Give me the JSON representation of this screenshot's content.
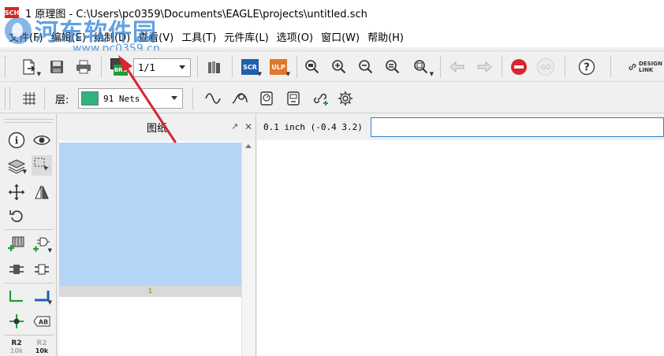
{
  "window": {
    "app_icon_text": "SCH",
    "title": "1 原理图 - C:\\Users\\pc0359\\Documents\\EAGLE\\projects\\untitled.sch"
  },
  "menu": {
    "items": [
      {
        "label": "文件(F)"
      },
      {
        "label": "编辑(E)"
      },
      {
        "label": "绘制(D)"
      },
      {
        "label": "查看(V)"
      },
      {
        "label": "工具(T)"
      },
      {
        "label": "元件库(L)"
      },
      {
        "label": "选项(O)"
      },
      {
        "label": "窗口(W)"
      },
      {
        "label": "帮助(H)"
      }
    ]
  },
  "watermark": {
    "title": "河东软件园",
    "url": "www.pc0359.cn"
  },
  "toolbar": {
    "sheet_select_value": "1/1",
    "scr_label": "SCR",
    "ulp_label": "ULP",
    "go_label": "GO",
    "design_link_label_line1": "DESIGN",
    "design_link_label_line2": "LINK",
    "brd_label": "BRD"
  },
  "toolbar2": {
    "layer_label": "层:",
    "layer_value": "91 Nets",
    "layer_color": "#2fb37f"
  },
  "sheets_panel": {
    "title": "图纸",
    "sheet_number": "1"
  },
  "status": {
    "coordinates": "0.1 inch (-0.4 3.2)"
  },
  "palette": {
    "r2_label": "R2",
    "r2_value": "10k"
  },
  "colors": {
    "accent_blue": "#1a5fb4",
    "scr_blue": "#1f5fa8",
    "ulp_orange": "#e0782b",
    "stop_red": "#d9252e",
    "sheet_blue": "#b3d5f6",
    "net_green": "#1aa03a",
    "annotation_red": "#d9252e"
  }
}
